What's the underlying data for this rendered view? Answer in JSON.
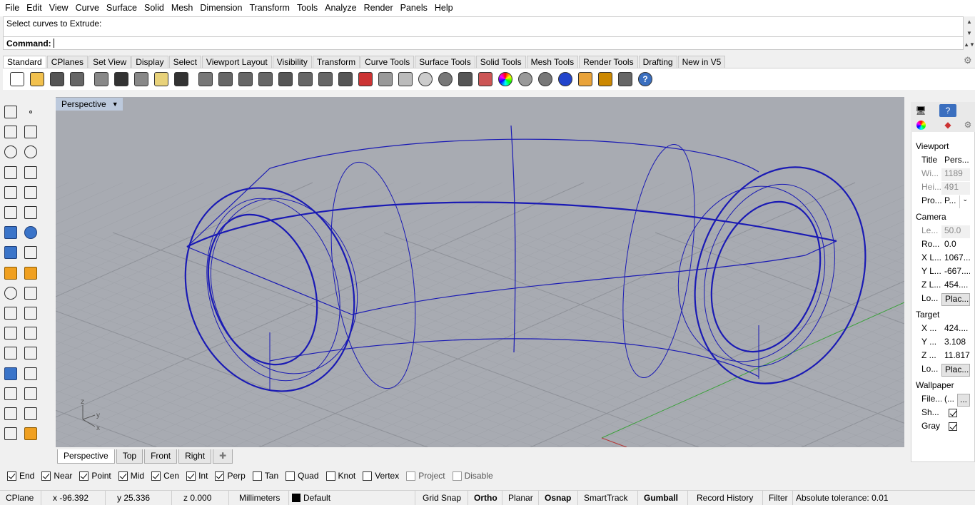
{
  "menu": [
    "File",
    "Edit",
    "View",
    "Curve",
    "Surface",
    "Solid",
    "Mesh",
    "Dimension",
    "Transform",
    "Tools",
    "Analyze",
    "Render",
    "Panels",
    "Help"
  ],
  "command": {
    "history": "Select curves to Extrude:",
    "prompt": "Command:"
  },
  "toolbar_tabs": [
    "Standard",
    "CPlanes",
    "Set View",
    "Display",
    "Select",
    "Viewport Layout",
    "Visibility",
    "Transform",
    "Curve Tools",
    "Surface Tools",
    "Solid Tools",
    "Mesh Tools",
    "Render Tools",
    "Drafting",
    "New in V5"
  ],
  "toolbar_icons": [
    "new-file-icon",
    "open-file-icon",
    "save-icon",
    "print-icon",
    "import-icon",
    "cut-icon",
    "copy-icon",
    "paste-icon",
    "undo-icon",
    "pan-icon",
    "rotate-view-icon",
    "zoom-icon",
    "zoom-window-icon",
    "zoom-extents-icon",
    "zoom-selected-icon",
    "rotate-camera-icon",
    "four-viewports-icon",
    "car-icon",
    "shade-icon",
    "ghosted-icon",
    "cplane-icon",
    "light-icon",
    "lock-icon",
    "layers-icon",
    "color-icon",
    "render-sphere-icon",
    "gloss-sphere-icon",
    "blue-sphere-icon",
    "selection-filter-icon",
    "options-gear-icon",
    "grid-snap-icon",
    "help-icon"
  ],
  "viewport": {
    "title": "Perspective",
    "tabs": [
      "Perspective",
      "Top",
      "Front",
      "Right"
    ],
    "axis_labels": {
      "z": "z",
      "y": "y",
      "x": "x"
    }
  },
  "osnap": [
    {
      "label": "End",
      "checked": true
    },
    {
      "label": "Near",
      "checked": true
    },
    {
      "label": "Point",
      "checked": true
    },
    {
      "label": "Mid",
      "checked": true
    },
    {
      "label": "Cen",
      "checked": true
    },
    {
      "label": "Int",
      "checked": true
    },
    {
      "label": "Perp",
      "checked": true
    },
    {
      "label": "Tan",
      "checked": false
    },
    {
      "label": "Quad",
      "checked": false
    },
    {
      "label": "Knot",
      "checked": false
    },
    {
      "label": "Vertex",
      "checked": false
    },
    {
      "label": "Project",
      "checked": false
    },
    {
      "label": "Disable",
      "checked": false
    }
  ],
  "status": {
    "cplane": "CPlane",
    "x": "x -96.392",
    "y": "y 25.336",
    "z": "z 0.000",
    "units": "Millimeters",
    "layer": "Default",
    "grid_snap": "Grid Snap",
    "ortho": "Ortho",
    "planar": "Planar",
    "osnap": "Osnap",
    "smarttrack": "SmartTrack",
    "gumball": "Gumball",
    "record_history": "Record History",
    "filter": "Filter",
    "tolerance": "Absolute tolerance: 0.01"
  },
  "properties": {
    "viewport_header": "Viewport",
    "title": {
      "k": "Title",
      "v": "Pers..."
    },
    "width": {
      "k": "Wi...",
      "v": "1189"
    },
    "height": {
      "k": "Hei...",
      "v": "491"
    },
    "projection": {
      "k": "Pro...",
      "v": "P..."
    },
    "camera_header": "Camera",
    "lens": {
      "k": "Le...",
      "v": "50.0"
    },
    "rotation": {
      "k": "Ro...",
      "v": "0.0"
    },
    "cam_x": {
      "k": "X L...",
      "v": "1067...."
    },
    "cam_y": {
      "k": "Y L...",
      "v": "-667...."
    },
    "cam_z": {
      "k": "Z L...",
      "v": "454...."
    },
    "cam_loc": {
      "k": "Lo...",
      "v": "Plac..."
    },
    "target_header": "Target",
    "tgt_x": {
      "k": "X ...",
      "v": "424...."
    },
    "tgt_y": {
      "k": "Y ...",
      "v": "3.108"
    },
    "tgt_z": {
      "k": "Z ...",
      "v": "11.817"
    },
    "tgt_loc": {
      "k": "Lo...",
      "v": "Plac..."
    },
    "wallpaper_header": "Wallpaper",
    "file": {
      "k": "File...",
      "v": "(..."
    },
    "file_btn": "...",
    "show": {
      "k": "Sh..."
    },
    "gray": {
      "k": "Gray"
    }
  },
  "colors": {
    "wire": "#1a1ab4",
    "viewport_bg": "#a8abb2",
    "grid": "#9a9da4",
    "x_axis": "#b43c3c",
    "y_axis": "#3ca03c"
  }
}
